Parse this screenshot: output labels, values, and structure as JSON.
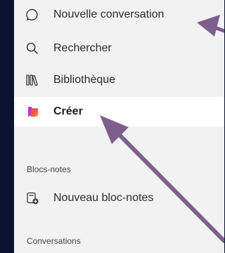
{
  "sidebar": {
    "items": [
      {
        "label": "Nouvelle conversation",
        "icon": "chat-bubble-icon"
      },
      {
        "label": "Rechercher",
        "icon": "search-icon"
      },
      {
        "label": "Bibliothèque",
        "icon": "library-icon"
      },
      {
        "label": "Créer",
        "icon": "create-icon"
      }
    ],
    "notebooks": {
      "header": "Blocs-notes",
      "new_notebook_label": "Nouveau bloc-notes"
    },
    "conversations": {
      "header": "Conversations"
    }
  },
  "colors": {
    "background": "#0c1230",
    "sidebar_bg": "#f2f2f2",
    "active_bg": "#ffffff",
    "arrow": "#7e5e8e"
  }
}
